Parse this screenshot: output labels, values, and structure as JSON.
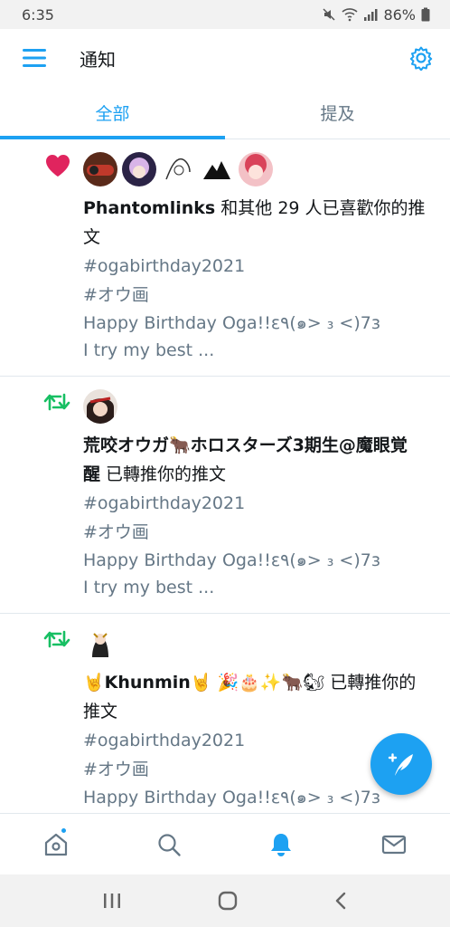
{
  "status_bar": {
    "time": "6:35",
    "battery": "86%"
  },
  "header": {
    "title": "通知"
  },
  "tabs": [
    {
      "label": "全部"
    },
    {
      "label": "提及"
    }
  ],
  "notifications": [
    {
      "type": "like",
      "actor": "Phantomlinks",
      "action_line1": " 和其他 29 人已喜歡你的推",
      "action_line2": "文",
      "tweet": {
        "hashtag1": "#ogabirthday2021",
        "hashtag2": "#オウ画",
        "text1": "Happy Birthday Oga!!ε٩(๑> ₃ <)7з",
        "text2": "I try my best ..."
      }
    },
    {
      "type": "retweet",
      "actor_line1": "荒咬オウガ🐂ホロスターズ3期生@魔眼覚",
      "actor_line2": "醒",
      "action": " 已轉推你的推文",
      "tweet": {
        "hashtag1": "#ogabirthday2021",
        "hashtag2": "#オウ画",
        "text1": "Happy Birthday Oga!!ε٩(๑> ₃ <)7з",
        "text2": "I try my best ..."
      }
    },
    {
      "type": "retweet",
      "actor_prefix": "🤘",
      "actor": "Khunmin",
      "actor_suffix": "🤘 🎉🎂✨🐂🐿",
      "action": " 已轉推你的",
      "action_line2": "推文",
      "tweet": {
        "hashtag1": "#ogabirthday2021",
        "hashtag2": "#オウ画",
        "text1": "Happy Birthday Oga!!ε٩(๑> ₃ <)7з"
      }
    }
  ],
  "colors": {
    "accent": "#1da1f2",
    "like": "#e0245e",
    "retweet": "#17bf63"
  }
}
